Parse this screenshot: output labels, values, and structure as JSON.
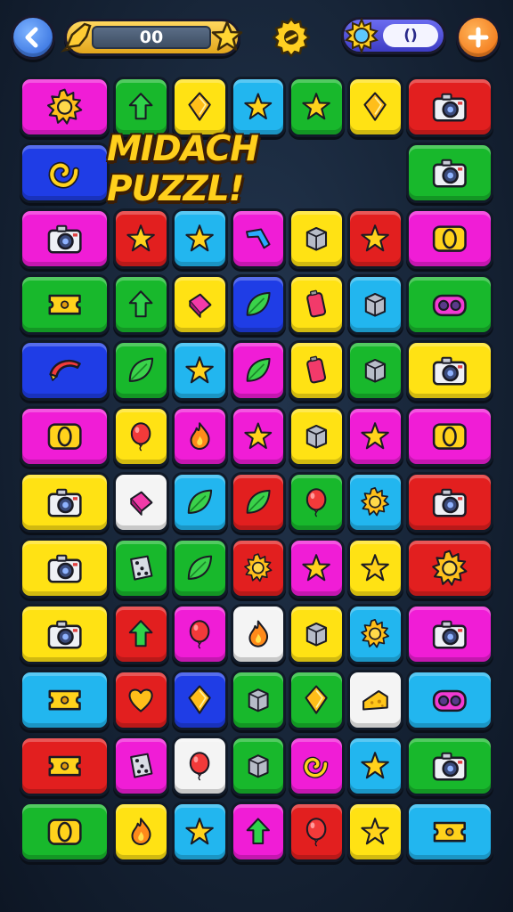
{
  "header": {
    "score_value": "00",
    "gem_value": "()",
    "icons": {
      "back": "back-arrow-icon",
      "rocket": "rocket-icon",
      "star": "star-icon",
      "settings": "gear-icon",
      "sun": "sun-icon",
      "add": "plus-icon"
    }
  },
  "title": "MIDACH PUZZL!",
  "colors": {
    "M": "#f01dd6",
    "G": "#18b82c",
    "Y": "#ffe214",
    "C": "#22b6ef",
    "R": "#e21f1f",
    "B": "#1f3de6",
    "W": "#f4f4f4"
  },
  "board": {
    "rows": [
      [
        {
          "c": "M",
          "i": "sun-icon"
        },
        {
          "c": "G",
          "i": "arrow-icon"
        },
        {
          "c": "Y",
          "i": "diamond-icon"
        },
        {
          "c": "C",
          "i": "star-icon"
        },
        {
          "c": "G",
          "i": "star-icon"
        },
        {
          "c": "Y",
          "i": "diamond-icon"
        },
        {
          "c": "R",
          "i": "camera-icon"
        }
      ],
      [
        {
          "c": "B",
          "i": "swirl-icon"
        },
        {
          "c": "G",
          "i": "camera-icon"
        }
      ],
      [
        {
          "c": "M",
          "i": "camera-icon"
        },
        {
          "c": "R",
          "i": "star-icon"
        },
        {
          "c": "C",
          "i": "star-icon"
        },
        {
          "c": "M",
          "i": "boomerang-icon"
        },
        {
          "c": "Y",
          "i": "box-icon"
        },
        {
          "c": "R",
          "i": "star-icon"
        },
        {
          "c": "M",
          "i": "coin-icon"
        }
      ],
      [
        {
          "c": "G",
          "i": "ticket-icon"
        },
        {
          "c": "G",
          "i": "arrow-icon"
        },
        {
          "c": "Y",
          "i": "eraser-icon"
        },
        {
          "c": "B",
          "i": "leaf-icon"
        },
        {
          "c": "Y",
          "i": "battery-icon"
        },
        {
          "c": "C",
          "i": "box-icon"
        },
        {
          "c": "G",
          "i": "binoculars-icon"
        }
      ],
      [
        {
          "c": "B",
          "i": "banana-icon"
        },
        {
          "c": "G",
          "i": "leaf-icon"
        },
        {
          "c": "C",
          "i": "star-icon"
        },
        {
          "c": "M",
          "i": "leaf-icon"
        },
        {
          "c": "Y",
          "i": "battery-icon"
        },
        {
          "c": "G",
          "i": "box-icon"
        },
        {
          "c": "Y",
          "i": "camera-icon"
        }
      ],
      [
        {
          "c": "M",
          "i": "coin-icon"
        },
        {
          "c": "Y",
          "i": "balloon-icon"
        },
        {
          "c": "M",
          "i": "flame-icon"
        },
        {
          "c": "M",
          "i": "star-icon"
        },
        {
          "c": "Y",
          "i": "box-icon"
        },
        {
          "c": "M",
          "i": "star-icon"
        },
        {
          "c": "M",
          "i": "coin-icon"
        }
      ],
      [
        {
          "c": "Y",
          "i": "camera-icon"
        },
        {
          "c": "W",
          "i": "eraser-icon"
        },
        {
          "c": "C",
          "i": "leaf-icon"
        },
        {
          "c": "R",
          "i": "leaf-icon"
        },
        {
          "c": "G",
          "i": "balloon-icon"
        },
        {
          "c": "C",
          "i": "sun-icon"
        },
        {
          "c": "R",
          "i": "camera-icon"
        }
      ],
      [
        {
          "c": "Y",
          "i": "camera-icon"
        },
        {
          "c": "G",
          "i": "dice-icon"
        },
        {
          "c": "G",
          "i": "leaf-icon"
        },
        {
          "c": "R",
          "i": "sun-icon"
        },
        {
          "c": "M",
          "i": "star-icon"
        },
        {
          "c": "Y",
          "i": "star-icon"
        },
        {
          "c": "R",
          "i": "sun-icon"
        }
      ],
      [
        {
          "c": "Y",
          "i": "camera-icon"
        },
        {
          "c": "R",
          "i": "arrow-icon"
        },
        {
          "c": "M",
          "i": "balloon-icon"
        },
        {
          "c": "W",
          "i": "flame-icon"
        },
        {
          "c": "Y",
          "i": "box-icon"
        },
        {
          "c": "C",
          "i": "sun-icon"
        },
        {
          "c": "M",
          "i": "camera-icon"
        }
      ],
      [
        {
          "c": "C",
          "i": "ticket-icon"
        },
        {
          "c": "R",
          "i": "heart-icon"
        },
        {
          "c": "B",
          "i": "diamond-icon"
        },
        {
          "c": "G",
          "i": "box-icon"
        },
        {
          "c": "G",
          "i": "diamond-icon"
        },
        {
          "c": "W",
          "i": "cheese-icon"
        },
        {
          "c": "C",
          "i": "binoculars-icon"
        }
      ],
      [
        {
          "c": "R",
          "i": "ticket-icon"
        },
        {
          "c": "M",
          "i": "dice-icon"
        },
        {
          "c": "W",
          "i": "balloon-icon"
        },
        {
          "c": "G",
          "i": "box-icon"
        },
        {
          "c": "M",
          "i": "swirl-icon"
        },
        {
          "c": "C",
          "i": "star-icon"
        },
        {
          "c": "G",
          "i": "camera-icon"
        }
      ],
      [
        {
          "c": "G",
          "i": "coin-icon"
        },
        {
          "c": "Y",
          "i": "flame-icon"
        },
        {
          "c": "C",
          "i": "star-icon"
        },
        {
          "c": "M",
          "i": "arrow-icon"
        },
        {
          "c": "R",
          "i": "balloon-icon"
        },
        {
          "c": "Y",
          "i": "star-icon"
        },
        {
          "c": "C",
          "i": "ticket-icon"
        }
      ]
    ]
  }
}
